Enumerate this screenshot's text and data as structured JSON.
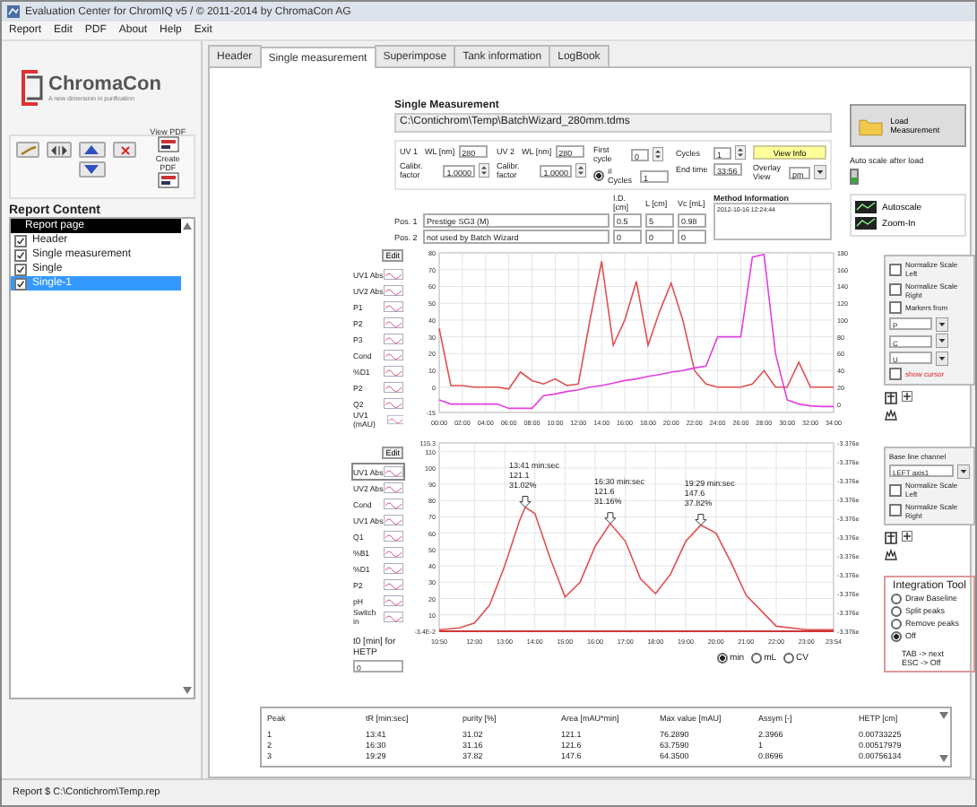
{
  "window": {
    "title": "Evaluation Center for ChromIQ v5 / © 2011-2014 by ChromaCon AG"
  },
  "menu": [
    "Report",
    "Edit",
    "PDF",
    "About",
    "Help",
    "Exit"
  ],
  "sidebar": {
    "logo_text": "ChromaCon",
    "tagline": "A new dimension in purification",
    "pdf_buttons": [
      "View PDF",
      "Create PDF"
    ],
    "report_content_title": "Report Content",
    "report_header": "Report page",
    "items": [
      {
        "label": "Header",
        "checked": true,
        "selected": false
      },
      {
        "label": "Single measurement",
        "checked": true,
        "selected": false
      },
      {
        "label": "Single",
        "checked": true,
        "selected": false
      },
      {
        "label": "Single-1",
        "checked": true,
        "selected": true
      }
    ]
  },
  "tabs": [
    {
      "label": "Header",
      "selected": false
    },
    {
      "label": "Single measurement",
      "selected": true
    },
    {
      "label": "Superimpose",
      "selected": false
    },
    {
      "label": "Tank information",
      "selected": false
    },
    {
      "label": "LogBook",
      "selected": false
    }
  ],
  "measurement": {
    "title": "Single Measurement",
    "path": "C:\\Contichrom\\Temp\\BatchWizard_280mm.tdms",
    "load_button": "Load Measurement",
    "auto_scale": {
      "label": "Auto scale after load",
      "on": true
    },
    "uv": [
      {
        "label": "UV 1",
        "wl_label": "WL [nm]",
        "wl": "280",
        "calib_label": "Calibr. factor",
        "calib": "1.0000"
      },
      {
        "label": "UV 2",
        "wl_label": "WL [nm]",
        "wl": "280",
        "calib_label": "Calibr. factor",
        "calib": "1.0000"
      }
    ],
    "first_cycle": {
      "label": "First cycle",
      "value": "0"
    },
    "n_cycles": {
      "label": "# Cycles",
      "value": "1",
      "selected": true
    },
    "cycles": {
      "label": "Cycles",
      "value": "1"
    },
    "end_time": {
      "label": "End time",
      "value": "33:56"
    },
    "view_info": "View Info",
    "overlay": {
      "label": "Overlay View",
      "value": "pm"
    },
    "column_headers": [
      "I.D. [cm]",
      "L [cm]",
      "Vc [mL]"
    ],
    "positions": [
      {
        "label": "Pos. 1",
        "column": "Prestige SG3 (M)",
        "id": "0.5",
        "l": "5",
        "vc": "0.98"
      },
      {
        "label": "Pos. 2",
        "column": "not used by Batch Wizard",
        "id": "0",
        "l": "0",
        "vc": "0"
      }
    ],
    "method_information": {
      "label": "Method Information",
      "value": "2012-10-16 12:24:44"
    },
    "scale_buttons": [
      "Autoscale",
      "Zoom-In"
    ]
  },
  "upper_channels": {
    "edit": "Edit",
    "items": [
      "UV1 Abs",
      "UV2 Abs",
      "P1",
      "P2",
      "P3",
      "Cond",
      "%D1",
      "P2",
      "Q2",
      "UV1 (mAU)"
    ]
  },
  "upper_chart": {
    "chart_data": {
      "type": "line",
      "x": [
        0,
        1,
        2,
        3,
        4,
        5,
        6,
        7,
        8,
        9,
        10,
        11,
        12,
        13,
        14,
        15,
        16,
        17,
        18,
        19,
        20,
        21,
        22,
        23,
        24,
        25,
        26,
        27,
        28,
        29,
        30,
        31,
        32,
        33,
        34
      ],
      "grid": true,
      "xlim": [
        0,
        34
      ],
      "ylim": [
        -15,
        80
      ],
      "y2lim": [
        -10,
        180
      ],
      "xticks": [
        {
          "value": 0,
          "label": "00:00"
        },
        {
          "value": 2,
          "label": "02:00"
        },
        {
          "value": 4,
          "label": "04:00"
        },
        {
          "value": 6,
          "label": "06:00"
        },
        {
          "value": 8,
          "label": "08:00"
        },
        {
          "value": 10,
          "label": "10:00"
        },
        {
          "value": 12,
          "label": "12:00"
        },
        {
          "value": 14,
          "label": "14:00"
        },
        {
          "value": 16,
          "label": "16:00"
        },
        {
          "value": 18,
          "label": "18:00"
        },
        {
          "value": 20,
          "label": "20:00"
        },
        {
          "value": 22,
          "label": "22:00"
        },
        {
          "value": 24,
          "label": "24:00"
        },
        {
          "value": 26,
          "label": "26:00"
        },
        {
          "value": 28,
          "label": "28:00"
        },
        {
          "value": 30,
          "label": "30:00"
        },
        {
          "value": 32,
          "label": "32:00"
        },
        {
          "value": 34,
          "label": "34:00"
        }
      ],
      "yticks": [
        -15,
        0,
        10,
        20,
        30,
        40,
        50,
        60,
        70,
        80
      ],
      "y2ticks": [
        0,
        20,
        40,
        60,
        80,
        100,
        120,
        140,
        160,
        180
      ],
      "series": [
        {
          "color": "#e05050",
          "values": [
            35,
            1,
            1,
            0,
            0,
            0,
            -1,
            9,
            4,
            2,
            5,
            1,
            2,
            40,
            75,
            25,
            40,
            63,
            25,
            45,
            62,
            40,
            10,
            2,
            0,
            0,
            0,
            2,
            10,
            0,
            0,
            15,
            0,
            0,
            0
          ]
        },
        {
          "color": "#e040e0",
          "axis": "y2",
          "values": [
            5,
            0,
            0,
            0,
            0,
            0,
            -5,
            -5,
            -5,
            10,
            12,
            15,
            17,
            20,
            22,
            25,
            28,
            30,
            33,
            35,
            38,
            40,
            43,
            45,
            80,
            80,
            80,
            175,
            178,
            60,
            5,
            0,
            -2,
            -3,
            -3
          ]
        }
      ]
    }
  },
  "lower_channels": {
    "edit": "Edit",
    "items": [
      {
        "label": "UV1 Abs",
        "selected": true
      },
      {
        "label": "UV2 Abs",
        "selected": false
      },
      {
        "label": "Cond",
        "selected": false
      },
      {
        "label": "UV1 Abs",
        "selected": false
      },
      {
        "label": "Q1",
        "selected": false
      },
      {
        "label": "%B1",
        "selected": false
      },
      {
        "label": "%D1",
        "selected": false
      },
      {
        "label": "P2",
        "selected": false
      },
      {
        "label": "pH",
        "selected": false
      },
      {
        "label": "Switch in",
        "selected": false
      }
    ],
    "hetp": {
      "label": "t0 [min] for HETP",
      "value": "0"
    }
  },
  "lower_chart": {
    "chart_data": {
      "type": "line",
      "x": [
        10.83,
        11.5,
        12,
        12.5,
        13,
        13.5,
        13.68,
        14,
        14.5,
        15,
        15.5,
        16,
        16.5,
        17,
        17.5,
        18,
        18.5,
        19,
        19.5,
        20,
        20.5,
        21,
        22,
        23,
        23.9
      ],
      "grid": true,
      "xlim": [
        10.83,
        23.9
      ],
      "ylim": [
        -0.034,
        115.3
      ],
      "xticks": [
        {
          "value": 10.83,
          "label": "10:50"
        },
        {
          "value": 12,
          "label": "12:00"
        },
        {
          "value": 13,
          "label": "13:00"
        },
        {
          "value": 14,
          "label": "14:00"
        },
        {
          "value": 15,
          "label": "15:00"
        },
        {
          "value": 16,
          "label": "16:00"
        },
        {
          "value": 17,
          "label": "17:00"
        },
        {
          "value": 18,
          "label": "18:00"
        },
        {
          "value": 19,
          "label": "19:00"
        },
        {
          "value": 20,
          "label": "20:00"
        },
        {
          "value": 21,
          "label": "21:00"
        },
        {
          "value": 22,
          "label": "22:00"
        },
        {
          "value": 23,
          "label": "23:00"
        },
        {
          "value": 23.9,
          "label": "23:54"
        }
      ],
      "yticks": [
        {
          "value": -0.034,
          "label": "-3.4E-2"
        },
        10,
        20,
        30,
        40,
        50,
        60,
        70,
        80,
        90,
        100,
        110,
        {
          "value": 115.3,
          "label": "115.3"
        }
      ],
      "series": [
        {
          "color": "#e05050",
          "values": [
            1,
            2,
            5,
            16,
            40,
            68,
            76,
            72,
            45,
            21,
            30,
            52,
            66,
            55,
            32,
            23,
            35,
            55,
            65,
            60,
            42,
            22,
            3,
            1,
            1
          ]
        },
        {
          "color": "#cc0000",
          "values": [
            0,
            0,
            0,
            0,
            0,
            0,
            0,
            0,
            0,
            0,
            0,
            0,
            0,
            0,
            0,
            0,
            0,
            0,
            0,
            0,
            0,
            0,
            0,
            0,
            0
          ]
        }
      ],
      "annotations": [
        {
          "x": 13.68,
          "y": 76,
          "text": "13:41 min:sec\n121.1\n31.02%"
        },
        {
          "x": 16.5,
          "y": 66,
          "text": "16:30 min:sec\n121.6\n31.16%"
        },
        {
          "x": 19.5,
          "y": 65,
          "text": "19:29 min:sec\n147.6\n37.82%"
        }
      ]
    },
    "right_axis_labels": [
      "-3.376e",
      "-3.376e",
      "-3.376e",
      "-3.376e",
      "-3.376e",
      "-3.376e",
      "-3.376e",
      "-3.376e",
      "-3.376e",
      "-3.376e",
      "-3.376e"
    ]
  },
  "x_unit": [
    {
      "label": "min",
      "selected": true
    },
    {
      "label": "mL",
      "selected": false
    },
    {
      "label": "CV",
      "selected": false
    }
  ],
  "upper_options": {
    "checks": [
      {
        "label": "Normalize Scale Left",
        "checked": false
      },
      {
        "label": "Normalize Scale Right",
        "checked": false
      },
      {
        "label": "Markers from",
        "checked": false
      }
    ],
    "dropdowns": [
      "P",
      "C",
      "U"
    ],
    "cursor": {
      "label": "show cursor",
      "checked": false
    }
  },
  "lower_options": {
    "baseline_label": "Base line channel",
    "baseline_value": "LEFT axis1",
    "checks": [
      {
        "label": "Normalize Scale Left",
        "checked": false
      },
      {
        "label": "Normalize Scale Right",
        "checked": false
      }
    ]
  },
  "integration_tool": {
    "title": "Integration Tool",
    "options": [
      {
        "label": "Draw Baseline",
        "selected": false
      },
      {
        "label": "Split peaks",
        "selected": false
      },
      {
        "label": "Remove peaks",
        "selected": false
      },
      {
        "label": "Off",
        "selected": true
      }
    ],
    "hints": [
      "TAB -> next",
      "ESC -> Off"
    ]
  },
  "peak_table": {
    "columns": [
      "Peak",
      "tR [min:sec]",
      "purity [%]",
      "Area [mAU*min]",
      "Max value [mAU]",
      "Assym [-]",
      "HETP [cm]"
    ],
    "rows": [
      [
        "1",
        "13:41",
        "31.02",
        "121.1",
        "76.2890",
        "2.3966",
        "0.00733225"
      ],
      [
        "2",
        "16:30",
        "31.16",
        "121.6",
        "63.7590",
        "1",
        "0.00517979"
      ],
      [
        "3",
        "19:29",
        "37.82",
        "147.6",
        "64.3500",
        "0.8696",
        "0.00756134"
      ]
    ]
  },
  "status_bar": "Report $ C:\\Contichrom\\Temp.rep"
}
